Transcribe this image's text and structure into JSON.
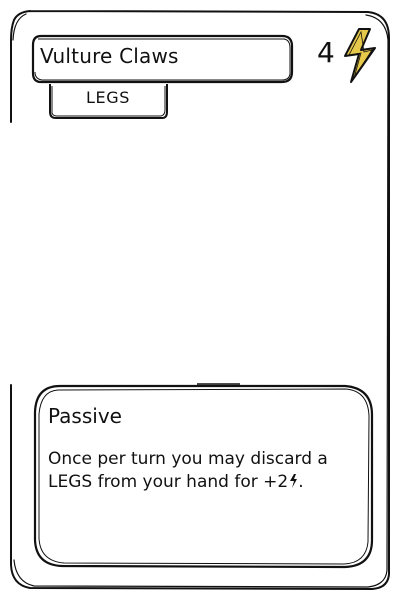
{
  "card": {
    "name": "Vulture Claws",
    "slot": "LEGS",
    "cost": "4",
    "cost_icon": "lightning-bolt-icon",
    "ability_type": "Passive",
    "ability_text": "Once per turn you may discard a LEGS from your hand for +2",
    "ability_text_icon": "lightning-bolt-icon",
    "ability_text_suffix": ".",
    "colors": {
      "stroke": "#111111",
      "energy": "#e6c84a",
      "background": "#ffffff"
    }
  }
}
